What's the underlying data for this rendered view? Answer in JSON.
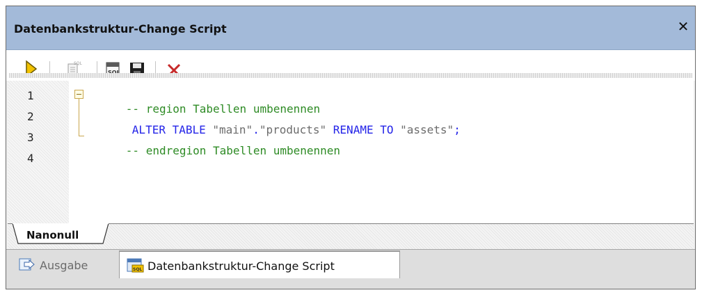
{
  "window": {
    "title": "Datenbankstruktur-Change Script",
    "close_symbol": "✕"
  },
  "toolbar": {
    "buttons": [
      {
        "name": "execute-icon",
        "tooltip": ""
      },
      {
        "name": "sql-script-icon",
        "tooltip": ""
      },
      {
        "name": "open-sql-editor-icon",
        "tooltip": ""
      },
      {
        "name": "save-icon",
        "tooltip": ""
      },
      {
        "name": "delete-icon",
        "tooltip": ""
      }
    ]
  },
  "editor": {
    "line_numbers": [
      "1",
      "2",
      "3",
      "4"
    ],
    "lines": [
      [
        {
          "text": "-- region Tabellen umbenennen",
          "kind": "comment"
        }
      ],
      [
        {
          "text": "ALTER TABLE ",
          "kind": "keyword"
        },
        {
          "text": "\"main\"",
          "kind": "string"
        },
        {
          "text": ".",
          "kind": "punct"
        },
        {
          "text": "\"products\"",
          "kind": "string"
        },
        {
          "text": " RENAME TO ",
          "kind": "keyword"
        },
        {
          "text": "\"assets\"",
          "kind": "string"
        },
        {
          "text": ";",
          "kind": "punct"
        }
      ],
      [
        {
          "text": "-- endregion Tabellen umbenennen",
          "kind": "comment"
        }
      ],
      []
    ]
  },
  "doc_tabs": [
    {
      "label": "Nanonull"
    }
  ],
  "panel_tabs": [
    {
      "label": "Ausgabe",
      "active": false,
      "icon": "output-icon"
    },
    {
      "label": "Datenbankstruktur-Change Script",
      "active": true,
      "icon": "sql-script-icon"
    }
  ],
  "colors": {
    "titlebar": "#a3bad9",
    "comment": "#2e8b25",
    "keyword": "#2424e8",
    "string": "#6c6c6c",
    "delete": "#c62a2a",
    "execute": "#f2c200"
  }
}
